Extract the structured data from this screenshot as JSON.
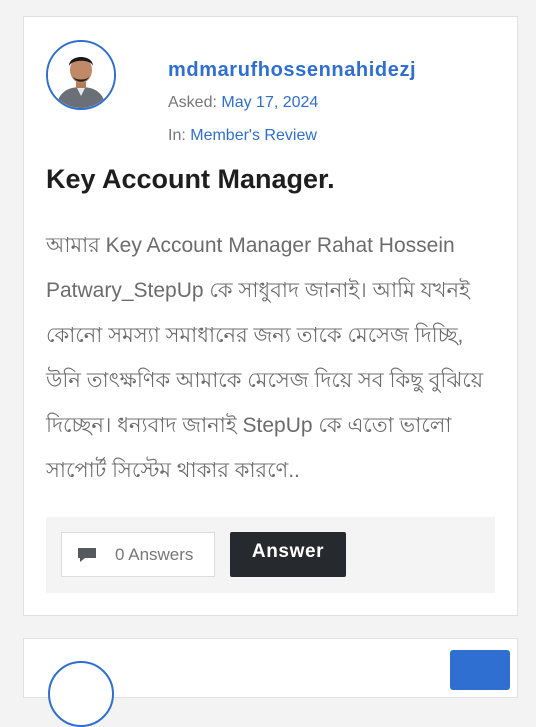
{
  "question": {
    "author": "mdmarufhossennahidezj",
    "asked_label": "Asked:",
    "asked_date": "May 17, 2024",
    "category_label": "In:",
    "category": "Member's Review",
    "title": "Key Account Manager.",
    "body": "আমার Key Account Manager Rahat Hossein Patwary_StepUp কে সাধুবাদ জানাই। আমি যখনই কোনো সমস্যা সমাধানের জন্য তাকে মেসেজ দিচ্ছি, উনি তাৎক্ষণিক আমাকে মেসেজ দিয়ে সব কিছু বুঝিয়ে দিচ্ছেন। ধন্যবাদ জানাই StepUp কে এতো ভালো সাপোর্ট সিস্টেম থাকার কারণে..",
    "answers_count_label": "0 Answers",
    "answer_button": "Answer"
  },
  "icons": {
    "answers": "comment-icon"
  },
  "colors": {
    "accent": "#2e6fd1",
    "dark_button": "#26292e"
  }
}
